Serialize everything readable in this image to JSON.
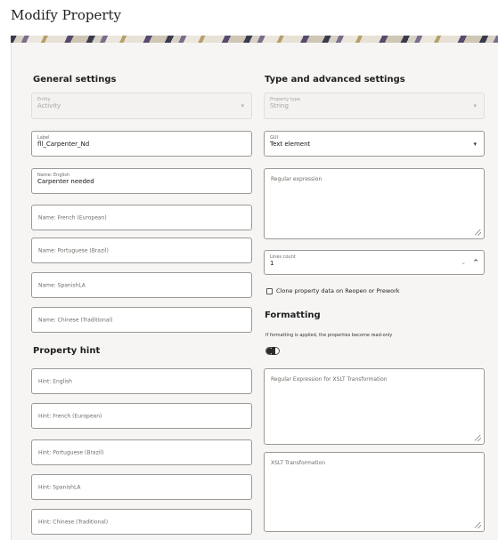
{
  "page": {
    "title": "Modify Property"
  },
  "general": {
    "title": "General settings",
    "entity": {
      "label": "Entity",
      "value": "Activity"
    },
    "label_field": {
      "label": "Label",
      "value": "fll_Carpenter_Nd"
    },
    "name_english": {
      "label": "Name: English",
      "value": "Carpenter needed"
    },
    "name_french": {
      "placeholder": "Name: French (European)"
    },
    "name_portuguese": {
      "placeholder": "Name: Portuguese (Brazil)"
    },
    "name_spanish": {
      "placeholder": "Name: SpanishLA"
    },
    "name_chinese": {
      "placeholder": "Name: Chinese (Traditional)"
    }
  },
  "hint": {
    "title": "Property hint",
    "english": {
      "placeholder": "Hint: English"
    },
    "french": {
      "placeholder": "Hint: French (European)"
    },
    "portuguese": {
      "placeholder": "Hint: Portuguese (Brazil)"
    },
    "spanish": {
      "placeholder": "Hint: SpanishLA"
    },
    "chinese": {
      "placeholder": "Hint: Chinese (Traditional)"
    }
  },
  "type": {
    "title": "Type and advanced settings",
    "property_type": {
      "label": "Property type",
      "value": "String"
    },
    "gui": {
      "label": "GUI",
      "value": "Text element"
    },
    "regex": {
      "placeholder": "Regular expression"
    },
    "lines_count": {
      "label": "Lines count",
      "value": "1"
    },
    "clone_label": "Clone property data on Reopen or Prework"
  },
  "formatting": {
    "title": "Formatting",
    "helper": "If formatting is applied, the properties become read-only",
    "toggle_on": false,
    "xslt_regex": {
      "placeholder": "Regular Expression for XSLT Transformation"
    },
    "xslt": {
      "placeholder": "XSLT Transformation"
    }
  },
  "icons": {
    "caret": "caret-down-icon",
    "stepper_down": "chevron-down-icon",
    "stepper_up": "chevron-up-icon",
    "resize": "resize-handle-icon"
  },
  "colors": {
    "panel_bg": "#f6f5f4",
    "border": "#9c9a96",
    "disabled_text": "#a8a6a2"
  }
}
